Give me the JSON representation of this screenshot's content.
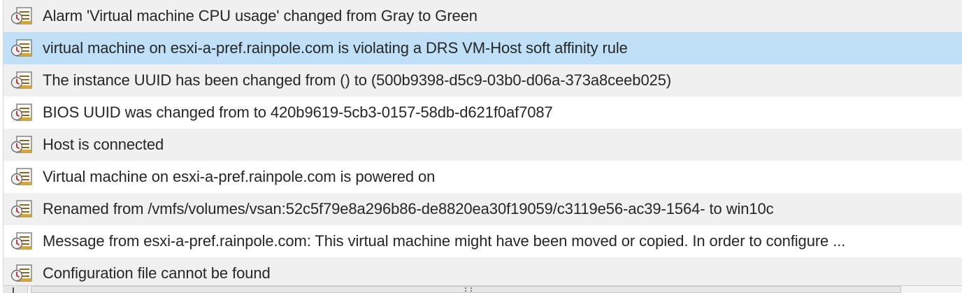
{
  "events": [
    {
      "icon": "info-event-icon",
      "text": "Alarm 'Virtual machine CPU usage' changed from Gray to Green",
      "selected": false
    },
    {
      "icon": "info-event-icon",
      "text": "virtual machine on esxi-a-pref.rainpole.com is violating a DRS VM-Host soft affinity rule",
      "selected": true
    },
    {
      "icon": "info-event-icon",
      "text": "The instance UUID has been changed from () to (500b9398-d5c9-03b0-d06a-373a8ceeb025)",
      "selected": false
    },
    {
      "icon": "info-event-icon",
      "text": "BIOS UUID was changed from  to 420b9619-5cb3-0157-58db-d621f0af7087",
      "selected": false
    },
    {
      "icon": "info-event-icon",
      "text": "Host is connected",
      "selected": false
    },
    {
      "icon": "info-event-icon",
      "text": "Virtual machine on esxi-a-pref.rainpole.com is powered on",
      "selected": false
    },
    {
      "icon": "info-event-icon",
      "text": "Renamed from /vmfs/volumes/vsan:52c5f79e8a296b86-de8820ea30f19059/c3119e56-ac39-1564- to win10c",
      "selected": false
    },
    {
      "icon": "info-event-icon",
      "text": "Message from esxi-a-pref.rainpole.com: This virtual machine might have been moved or copied. In order to configure ...",
      "selected": false
    },
    {
      "icon": "info-event-icon",
      "text": "Configuration file cannot be found",
      "selected": false
    }
  ],
  "colors": {
    "row_alt": "#f0f0f0",
    "row_plain": "#ffffff",
    "row_selected": "#bfe0f6",
    "text": "#262626"
  }
}
